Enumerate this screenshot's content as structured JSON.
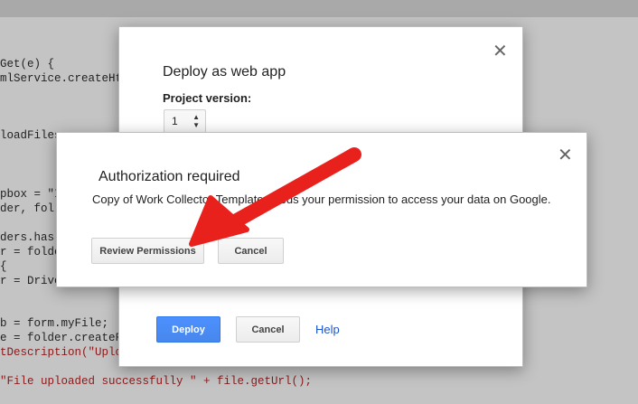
{
  "background_code": [
    {
      "text": "Get(e) {",
      "class": ""
    },
    {
      "text": "mlService.createHt",
      "class": ""
    },
    {
      "text": "loadFiles",
      "class": ""
    },
    {
      "text": "pbox = \"I",
      "class": ""
    },
    {
      "text": "der, fol",
      "class": ""
    },
    {
      "text": "ders.has",
      "class": ""
    },
    {
      "text": "r = folde",
      "class": ""
    },
    {
      "text": "{",
      "class": ""
    },
    {
      "text": "r = Drive",
      "class": ""
    },
    {
      "text": "b = form.myFile;",
      "class": ""
    },
    {
      "text": "e = folder.createF",
      "class": ""
    },
    {
      "text": "tDescription(\"Uplo",
      "class": "str"
    },
    {
      "text": "\"File uploaded successfully \" + file.getUrl();",
      "class": "str"
    }
  ],
  "deploy_dialog": {
    "title": "Deploy as web app",
    "project_version_label": "Project version:",
    "version_value": "1",
    "deploy_label": "Deploy",
    "cancel_label": "Cancel",
    "help_label": "Help",
    "close_glyph": "✕"
  },
  "auth_dialog": {
    "title": "Authorization required",
    "message": "Copy of Work Collector Template needs your permission to access your data on Google.",
    "review_label": "Review Permissions",
    "cancel_label": "Cancel",
    "close_glyph": "✕"
  },
  "colors": {
    "arrow": "#e8211d",
    "primary_button": "#4787ed"
  }
}
